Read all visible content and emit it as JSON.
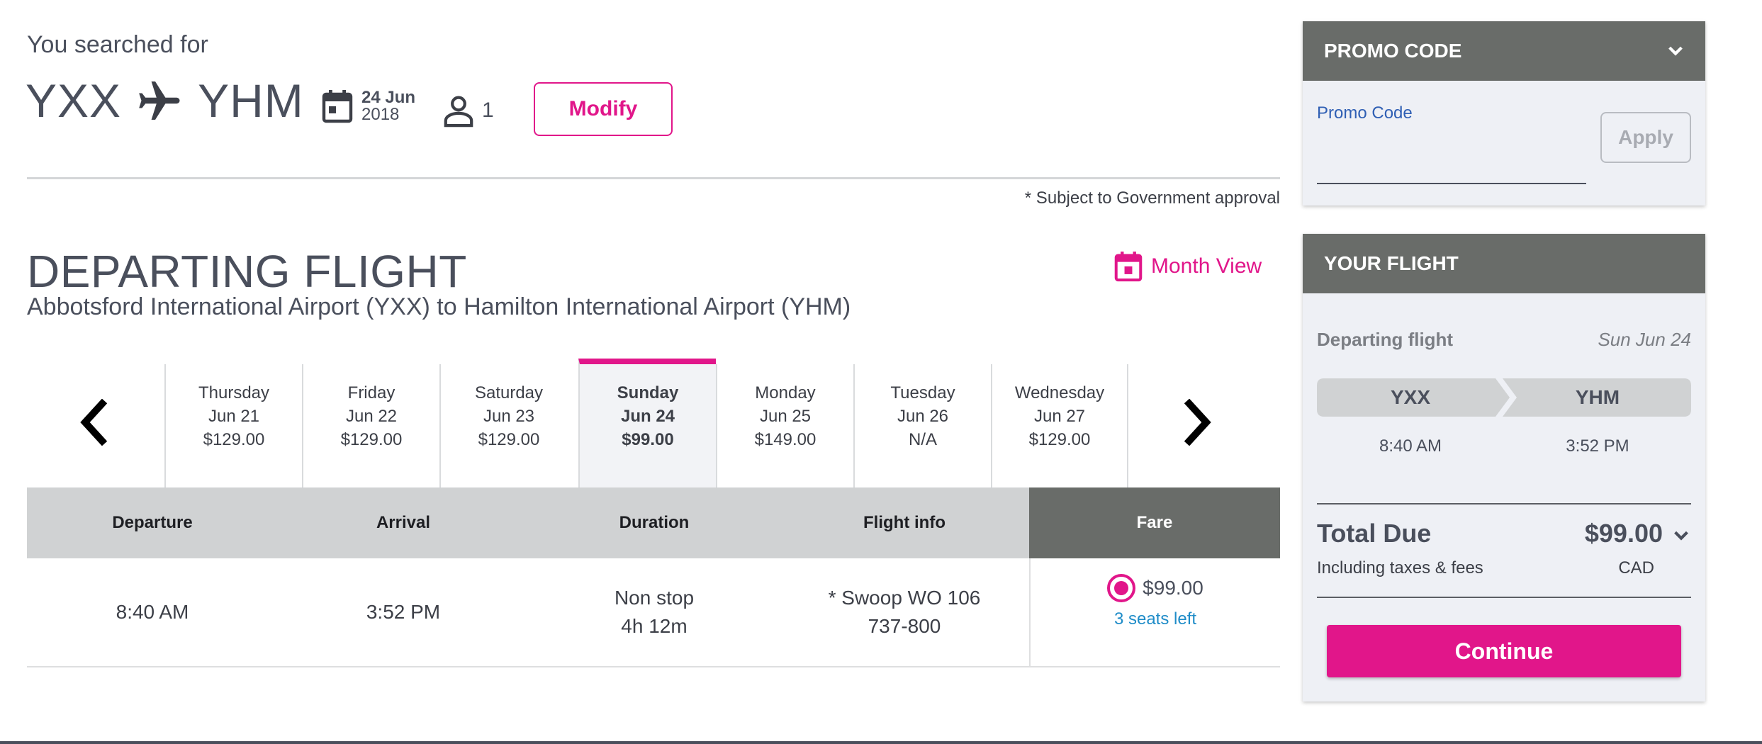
{
  "search": {
    "heading": "You searched for",
    "origin": "YXX",
    "destination": "YHM",
    "date_day": "24 Jun",
    "date_year": "2018",
    "passengers": "1",
    "modify_label": "Modify",
    "gov_note": "* Subject to Government approval"
  },
  "departing": {
    "title": "DEPARTING FLIGHT",
    "subtitle": "Abbotsford International Airport (YXX) to Hamilton International Airport (YHM)",
    "month_view_label": "Month View"
  },
  "days": [
    {
      "weekday": "Thursday",
      "date": "Jun 21",
      "price": "$129.00"
    },
    {
      "weekday": "Friday",
      "date": "Jun 22",
      "price": "$129.00"
    },
    {
      "weekday": "Saturday",
      "date": "Jun 23",
      "price": "$129.00"
    },
    {
      "weekday": "Sunday",
      "date": "Jun 24",
      "price": "$99.00",
      "selected": true
    },
    {
      "weekday": "Monday",
      "date": "Jun 25",
      "price": "$149.00"
    },
    {
      "weekday": "Tuesday",
      "date": "Jun 26",
      "price": "N/A"
    },
    {
      "weekday": "Wednesday",
      "date": "Jun 27",
      "price": "$129.00"
    }
  ],
  "table": {
    "headers": {
      "departure": "Departure",
      "arrival": "Arrival",
      "duration": "Duration",
      "flight_info": "Flight info",
      "fare": "Fare"
    },
    "row": {
      "departure": "8:40 AM",
      "arrival": "3:52 PM",
      "stops": "Non stop",
      "duration": "4h 12m",
      "flight": "* Swoop WO 106",
      "aircraft": "737-800",
      "fare": "$99.00",
      "seats_left": "3 seats left"
    }
  },
  "promo": {
    "header": "PROMO CODE",
    "label": "Promo Code",
    "value": "",
    "apply_label": "Apply"
  },
  "your_flight": {
    "header": "YOUR FLIGHT",
    "departing_label": "Departing flight",
    "departing_date": "Sun Jun 24",
    "origin": "YXX",
    "destination": "YHM",
    "depart_time": "8:40 AM",
    "arrive_time": "3:52 PM",
    "total_label": "Total Due",
    "total_sub": "Including taxes & fees",
    "total_amount": "$99.00",
    "currency": "CAD",
    "continue_label": "Continue"
  },
  "colors": {
    "accent": "#e1168a",
    "panel_header": "#696c69",
    "table_header": "#d0d2d3",
    "link": "#1f8cc8"
  }
}
